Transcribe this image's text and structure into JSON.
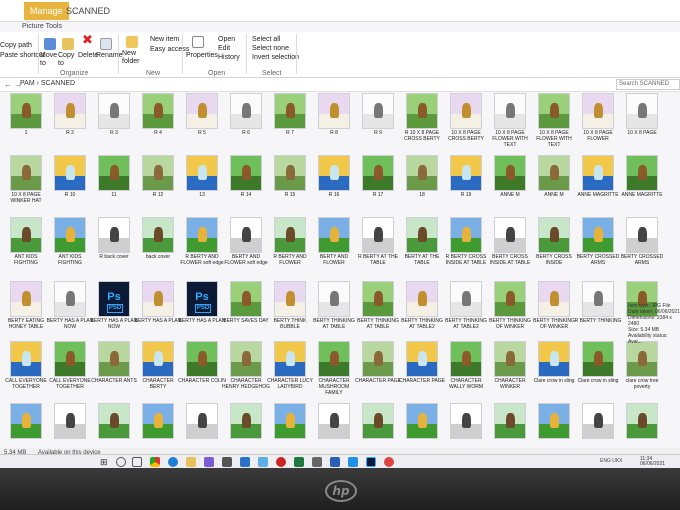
{
  "window": {
    "manage_tab": "Manage",
    "title_tab": "SCANNED",
    "context_tab": "Picture Tools"
  },
  "ribbon": {
    "copy_path": "Copy path",
    "paste_shortcut": "Paste shortcut",
    "move_to": "Move to",
    "copy_to": "Copy to",
    "delete": "Delete",
    "rename": "Rename",
    "new_folder": "New folder",
    "new_item": "New item",
    "easy_access": "Easy access",
    "properties": "Properties",
    "open": "Open",
    "edit": "Edit",
    "history": "History",
    "select_all": "Select all",
    "select_none": "Select none",
    "invert_selection": "Invert selection",
    "groups": [
      "Organize",
      "New",
      "Open",
      "Select"
    ]
  },
  "address": {
    "path": "PAM › SCANNED",
    "search_placeholder": "Search SCANNED"
  },
  "files": [
    [
      "1",
      "R 2",
      "R 3",
      "R 4",
      "R 5",
      "R 6",
      "R 7",
      "R 8",
      "R 9",
      "R 10 X 8 PAGE CROSS BERTY",
      "10 X 8 PAGE CROSS BERTY",
      "10 X 8 PAGE FLOWER WITH TEXT",
      "10 X 8 PAGE FLOWER WITH TEXT",
      "10 X 8 PAGE FLOWER",
      "10 X 8 PAGE"
    ],
    [
      "10 X 8 PAGE WINKER HAT",
      "R 10",
      "11",
      "R 12",
      "13",
      "R 14",
      "R 15",
      "R 16",
      "R 17",
      "18",
      "R 19",
      "ANNE M",
      "ANNE M",
      "ANNE MAGRITTE",
      "ANNE MAGRITTE"
    ],
    [
      "ANT KIDS FIGHTING",
      "ANT KIDS FIGHTING",
      "R back cover",
      "back cover",
      "R BERTY AND FLOWER soft edge",
      "BERTY AND FLOWER soft edge",
      "R BERTY AND FLOWER",
      "BERTY AND FLOWER",
      "R BERTY AT THE TABLE",
      "BERTY AT THE TABLE",
      "R BERTY CROSS INSIDE AT TABLE",
      "BERTY CROSS INSIDE AT TABLE",
      "BERTY CROSS INSIDE",
      "BERTY CROSSED ARMS",
      "BERTY CROSSED ARMS"
    ],
    [
      "BERTY EATING HONEY TABLE",
      "BERTY HAS A PLAN NOW",
      "BERTY HAS A PLAN NOW",
      "BERTY HAS A PLAN",
      "BERTY HAS A PLAN",
      "BERTY SAVES DAY",
      "BERTY THINK BUBBLE",
      "BERTY THINKING AT TABLE",
      "BERTY THINKING AT TABLE",
      "BERTY THINKING AT TABLE2",
      "BERTY THINKING AT TABLE2",
      "BERTY THINKING OF WINKER",
      "BERTY THINKING OF WINKER",
      "R BERTY THINKING",
      ""
    ],
    [
      "CALL EVERYONE TOGETHER",
      "CALL EVERYONE TOGETHER",
      "CHARACTER ANTS",
      "CHARACTER BERTY",
      "CHARACTER COLIN",
      "CHARACTER HENRY HEDGEHOG",
      "CHARACTER LUCY LADYBIRD",
      "CHARACTER MUSHROOM FAMILY",
      "CHARACTER PAGE",
      "CHARACTER PAGE",
      "CHARACTER WALLY WORM",
      "CHARACTER WINKER",
      "Clare crow in sling",
      "Clare crow in sling",
      "clare crow tree poverty"
    ],
    [
      "",
      "",
      "",
      "",
      "",
      "",
      "",
      "",
      "",
      "",
      "",
      "",
      "",
      "",
      ""
    ]
  ],
  "details": {
    "item_type": "Item type: JPG File",
    "date_taken": "Date taken: 06/06/2021",
    "dimensions": "Dimensions: 2384 x 2480",
    "size": "Size: 5.34 MB",
    "availability": "Availability status: Avai..."
  },
  "status": {
    "size": "5.34 MB",
    "availability": "Available on this device"
  },
  "tray": {
    "lang": "ENG",
    "region": "UKX",
    "clock_time": "11:34",
    "clock_date": "06/06/2021"
  },
  "colors": {
    "manage_accent": "#e9b43e",
    "psd_bg": "#0c1b35",
    "psd_fg": "#31a8ff",
    "screen_bg": "#f6f6f8"
  }
}
